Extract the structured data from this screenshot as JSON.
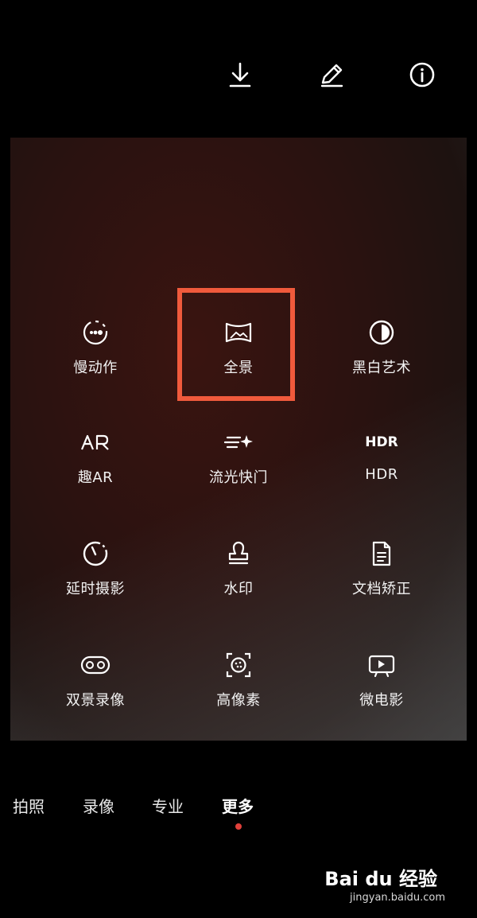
{
  "top_actions": [
    {
      "id": "download",
      "icon": "download-icon"
    },
    {
      "id": "edit",
      "icon": "pencil-icon"
    },
    {
      "id": "info",
      "icon": "info-icon"
    }
  ],
  "modes": [
    {
      "label": "慢动作",
      "icon": "slow-motion-icon"
    },
    {
      "label": "全景",
      "icon": "panorama-icon",
      "highlighted": true
    },
    {
      "label": "黑白艺术",
      "icon": "monochrome-icon"
    },
    {
      "label": "趣AR",
      "icon": "ar-icon",
      "icon_text": "AR"
    },
    {
      "label": "流光快门",
      "icon": "light-trail-shutter-icon"
    },
    {
      "label": "HDR",
      "icon": "hdr-icon",
      "icon_text": "HDR"
    },
    {
      "label": "延时摄影",
      "icon": "timelapse-icon"
    },
    {
      "label": "水印",
      "icon": "watermark-stamp-icon"
    },
    {
      "label": "文档矫正",
      "icon": "document-icon"
    },
    {
      "label": "双景录像",
      "icon": "dual-view-icon"
    },
    {
      "label": "高像素",
      "icon": "high-resolution-icon"
    },
    {
      "label": "微电影",
      "icon": "micro-movie-icon"
    }
  ],
  "mode_tabs": [
    {
      "label": "拍照"
    },
    {
      "label": "录像"
    },
    {
      "label": "专业"
    },
    {
      "label": "更多",
      "active": true
    }
  ],
  "highlight_color": "#f05a3c",
  "active_dot_color": "#e0403a",
  "watermark": {
    "logo": "Bai du 经验",
    "url": "jingyan.baidu.com"
  }
}
